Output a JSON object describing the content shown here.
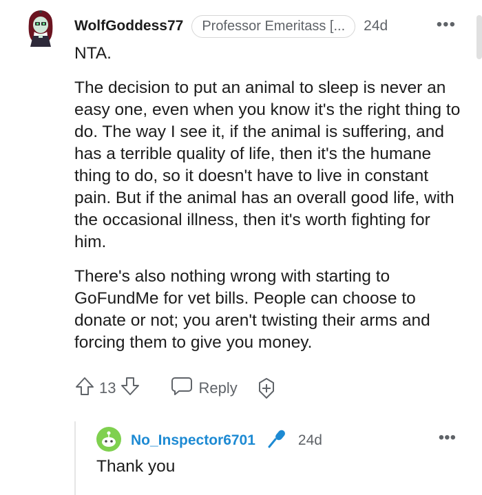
{
  "comment": {
    "username": "WolfGoddess77",
    "flair": "Professor Emeritass [...",
    "time": "24d",
    "more": "•••",
    "paragraphs": [
      "NTA.",
      "The decision to put an animal to sleep is never an easy one, even when you know it's the right thing to do. The way I see it, if the animal is suffering, and has a terrible quality of life, then it's the humane thing to do, so it doesn't have to live in constant pain. But if the animal has an overall good life, with the occasional illness, then it's worth fighting for him.",
      "There's also nothing wrong with starting to GoFundMe for vet bills. People can choose to donate or not; you aren't twisting their arms and forcing them to give you money."
    ],
    "vote_count": "13",
    "reply_label": "Reply"
  },
  "reply": {
    "username": "No_Inspector6701",
    "time": "24d",
    "more": "•••",
    "body": "Thank you"
  },
  "colors": {
    "username_link": "#1d8ad3",
    "muted": "#5f6368",
    "snoo_green": "#7fd04f"
  },
  "icons": [
    "upvote-icon",
    "downvote-icon",
    "comment-bubble-icon",
    "award-add-icon",
    "microphone-icon"
  ]
}
